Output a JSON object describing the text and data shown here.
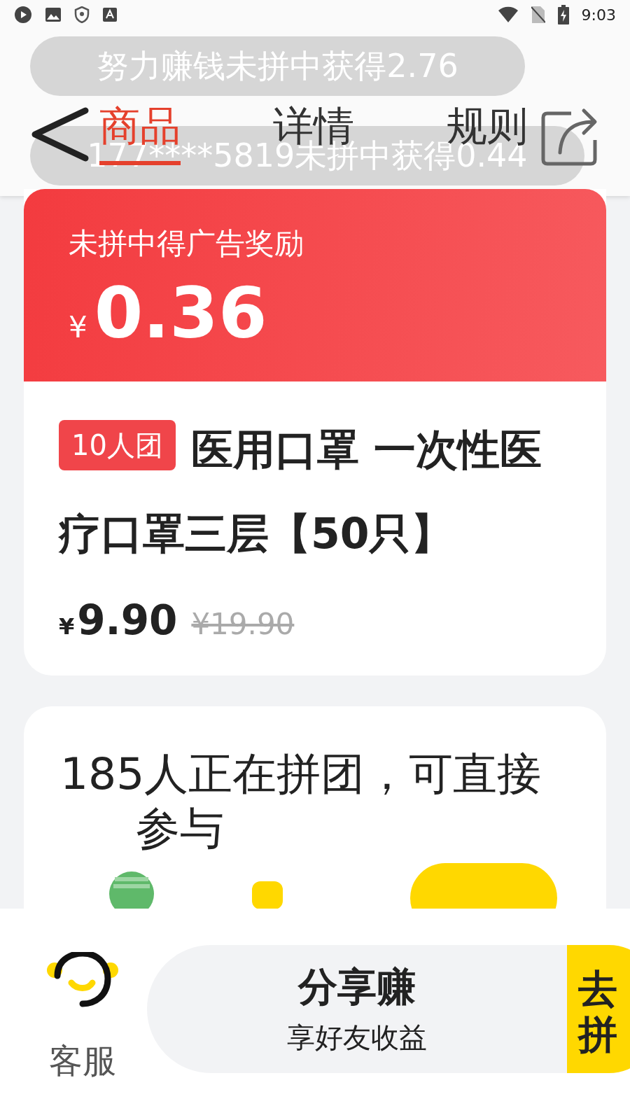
{
  "status_bar": {
    "time": "9:03"
  },
  "toasts": [
    "努力赚钱未拼中获得2.76",
    "177****5819未拼中获得0.44"
  ],
  "tabs": [
    {
      "label": "商品",
      "selected": true
    },
    {
      "label": "详情",
      "selected": false
    },
    {
      "label": "规则",
      "selected": false
    }
  ],
  "reward": {
    "label": "未拼中得广告奖励",
    "currency": "¥",
    "amount": "0.36"
  },
  "product": {
    "badge": "10人团",
    "title_lines": [
      "医用口罩 一次性医",
      "疗口罩三层【50只】"
    ],
    "currency": "¥",
    "price": "9.90",
    "original_price": "¥19.90"
  },
  "group": {
    "text": "185人正在拼团，可直接参与"
  },
  "bottom_bar": {
    "service_label": "客服",
    "share_title": "分享赚",
    "share_subtitle": "享好友收益",
    "join_label": "去拼"
  }
}
